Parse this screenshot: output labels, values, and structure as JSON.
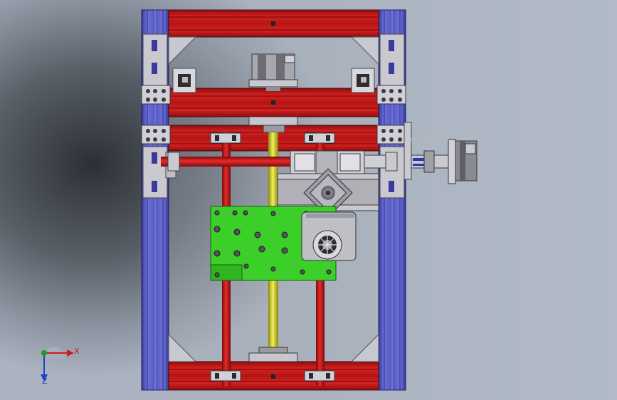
{
  "view": {
    "background_color": "#8f98a4",
    "axis_labels": {
      "x": "X",
      "z": "Z"
    },
    "axis_colors": {
      "x": "#c81e1e",
      "y": "#1e9a2a",
      "z": "#2040c8"
    }
  },
  "model": {
    "parts": [
      "aluminium-extrusion-frame",
      "red-crossbars",
      "red-guide-rods",
      "yellow-lead-screw",
      "stepper-motor-y",
      "stepper-motor-x",
      "stepper-motor-carriage",
      "green-pcb-board",
      "extruder-fan"
    ],
    "colors": {
      "frame": "#5a5ec8",
      "frame_dark": "#2e3190",
      "crossbar": "#d21a1a",
      "crossbar_dark": "#8a1010",
      "rod": "#d31b1b",
      "screw": "#e5e21e",
      "pcb": "#3bd32a",
      "bracket": "#c9c9cf",
      "motor": "#9a9aa2"
    }
  }
}
